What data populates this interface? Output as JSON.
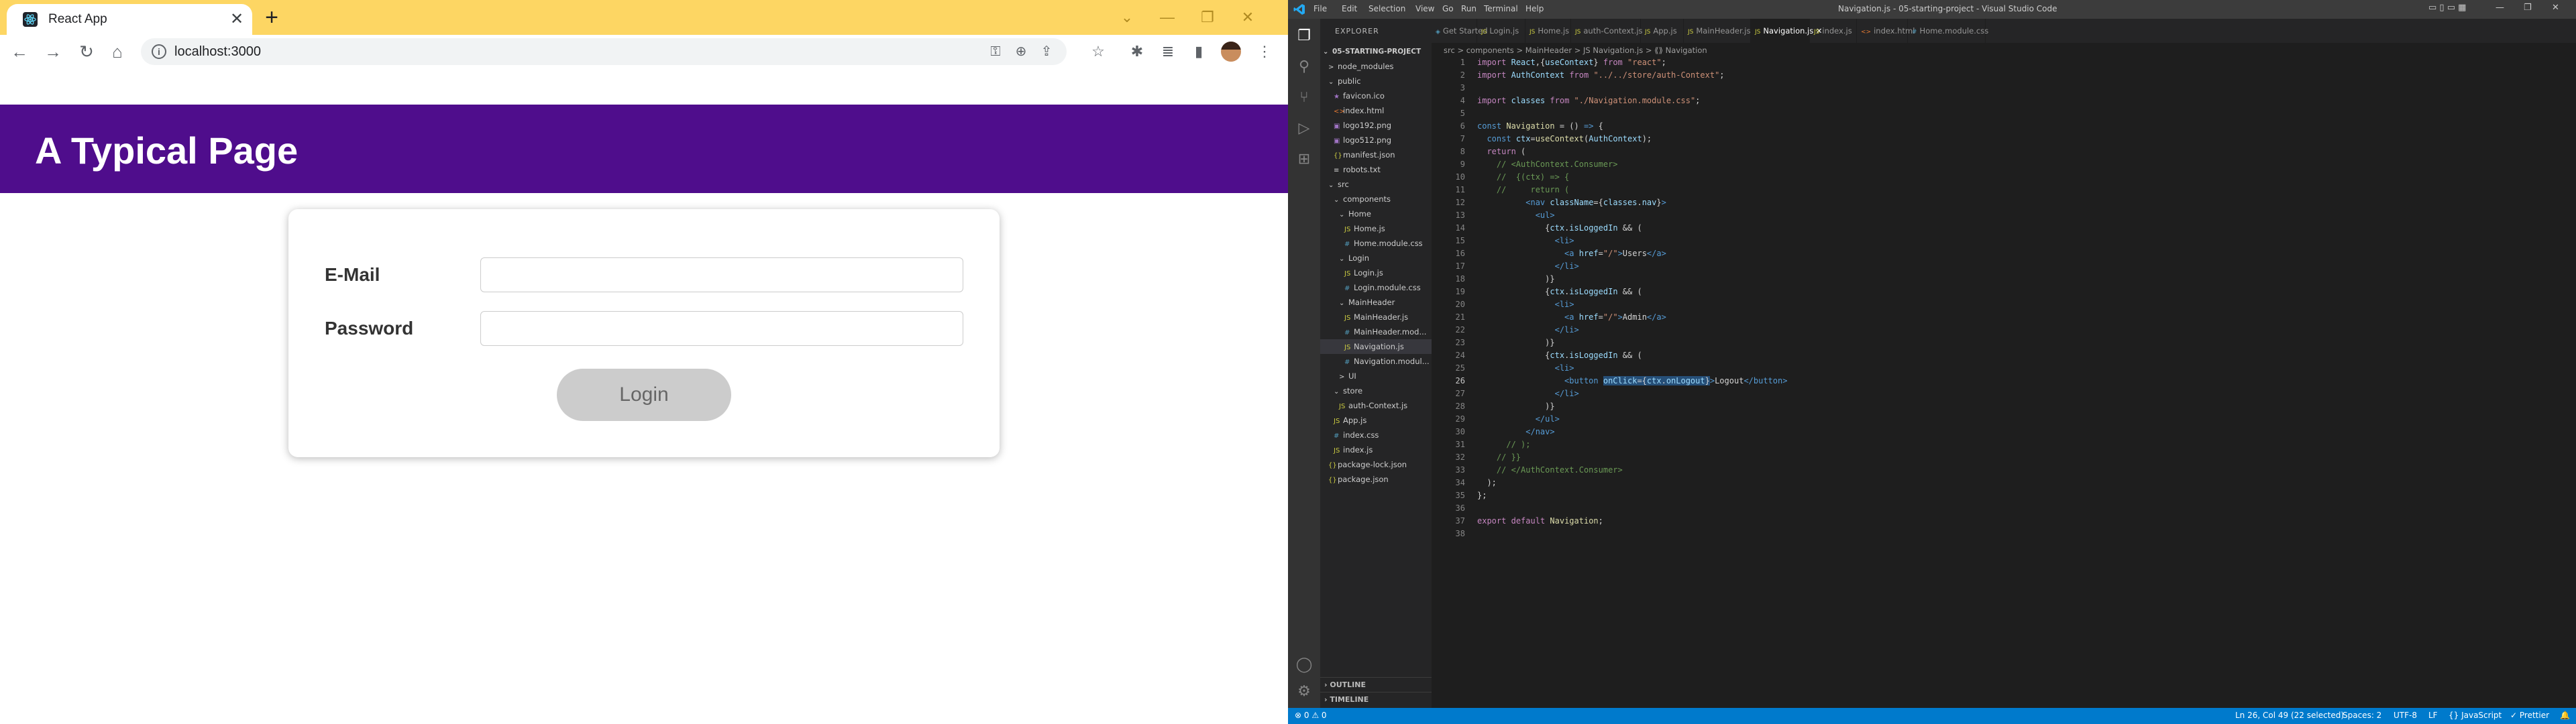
{
  "browser": {
    "tab_title": "React App",
    "tab_close": "✕",
    "new_tab": "+",
    "url": "localhost:3000",
    "controls": [
      "⌄",
      "—",
      "❐",
      "✕"
    ],
    "nav": [
      "←",
      "→",
      "↻",
      "⌂"
    ]
  },
  "app": {
    "header_title": "A Typical Page",
    "email_label": "E-Mail",
    "password_label": "Password",
    "login_button": "Login"
  },
  "vscode": {
    "window_title": "Navigation.js - 05-starting-project - Visual Studio Code",
    "menu": [
      "File",
      "Edit",
      "Selection",
      "View",
      "Go",
      "Run",
      "Terminal",
      "Help"
    ],
    "explorer_title": "EXPLORER",
    "project": "05-STARTING-PROJECT",
    "tree": [
      {
        "label": "node_modules",
        "indent": 1,
        "icon": ">",
        "kind": "folder"
      },
      {
        "label": "public",
        "indent": 1,
        "icon": "⌄",
        "kind": "folder"
      },
      {
        "label": "favicon.ico",
        "indent": 2,
        "icon": "★",
        "kind": "img"
      },
      {
        "label": "index.html",
        "indent": 2,
        "icon": "<>",
        "kind": "html"
      },
      {
        "label": "logo192.png",
        "indent": 2,
        "icon": "▣",
        "kind": "img"
      },
      {
        "label": "logo512.png",
        "indent": 2,
        "icon": "▣",
        "kind": "img"
      },
      {
        "label": "manifest.json",
        "indent": 2,
        "icon": "{}",
        "kind": "json"
      },
      {
        "label": "robots.txt",
        "indent": 2,
        "icon": "≡",
        "kind": "folder"
      },
      {
        "label": "src",
        "indent": 1,
        "icon": "⌄",
        "kind": "folder"
      },
      {
        "label": "components",
        "indent": 2,
        "icon": "⌄",
        "kind": "folder"
      },
      {
        "label": "Home",
        "indent": 3,
        "icon": "⌄",
        "kind": "folder"
      },
      {
        "label": "Home.js",
        "indent": 4,
        "icon": "JS",
        "kind": "js"
      },
      {
        "label": "Home.module.css",
        "indent": 4,
        "icon": "#",
        "kind": "css"
      },
      {
        "label": "Login",
        "indent": 3,
        "icon": "⌄",
        "kind": "folder"
      },
      {
        "label": "Login.js",
        "indent": 4,
        "icon": "JS",
        "kind": "js"
      },
      {
        "label": "Login.module.css",
        "indent": 4,
        "icon": "#",
        "kind": "css"
      },
      {
        "label": "MainHeader",
        "indent": 3,
        "icon": "⌄",
        "kind": "folder"
      },
      {
        "label": "MainHeader.js",
        "indent": 4,
        "icon": "JS",
        "kind": "js"
      },
      {
        "label": "MainHeader.mod...",
        "indent": 4,
        "icon": "#",
        "kind": "css"
      },
      {
        "label": "Navigation.js",
        "indent": 4,
        "icon": "JS",
        "kind": "js",
        "selected": true
      },
      {
        "label": "Navigation.modul...",
        "indent": 4,
        "icon": "#",
        "kind": "css"
      },
      {
        "label": "UI",
        "indent": 3,
        "icon": ">",
        "kind": "folder"
      },
      {
        "label": "store",
        "indent": 2,
        "icon": "⌄",
        "kind": "folder"
      },
      {
        "label": "auth-Context.js",
        "indent": 3,
        "icon": "JS",
        "kind": "js"
      },
      {
        "label": "App.js",
        "indent": 2,
        "icon": "JS",
        "kind": "js"
      },
      {
        "label": "index.css",
        "indent": 2,
        "icon": "#",
        "kind": "css"
      },
      {
        "label": "index.js",
        "indent": 2,
        "icon": "JS",
        "kind": "js"
      },
      {
        "label": "package-lock.json",
        "indent": 1,
        "icon": "{}",
        "kind": "json"
      },
      {
        "label": "package.json",
        "indent": 1,
        "icon": "{}",
        "kind": "json"
      }
    ],
    "outline": "OUTLINE",
    "timeline": "TIMELINE",
    "tabs": [
      {
        "label": "Get Started",
        "icon": "◈",
        "kind": "css"
      },
      {
        "label": "Login.js",
        "icon": "JS",
        "kind": "js"
      },
      {
        "label": "Home.js",
        "icon": "JS",
        "kind": "js"
      },
      {
        "label": "auth-Context.js",
        "icon": "JS",
        "kind": "js"
      },
      {
        "label": "App.js",
        "icon": "JS",
        "kind": "js"
      },
      {
        "label": "MainHeader.js",
        "icon": "JS",
        "kind": "js"
      },
      {
        "label": "Navigation.js",
        "icon": "JS",
        "kind": "js",
        "active": true
      },
      {
        "label": "index.js",
        "icon": "JS",
        "kind": "js"
      },
      {
        "label": "index.html",
        "icon": "<>",
        "kind": "html"
      },
      {
        "label": "Home.module.css",
        "icon": "#",
        "kind": "css"
      }
    ],
    "breadcrumb": "src > components > MainHeader > JS Navigation.js > ⟪⟫ Navigation",
    "status_left": "⊗ 0 ⚠ 0",
    "status_right": [
      "Ln 26, Col 49 (22 selected)",
      "Spaces: 2",
      "UTF-8",
      "LF",
      "{} JavaScript",
      "✓ Prettier",
      "🔔"
    ]
  }
}
